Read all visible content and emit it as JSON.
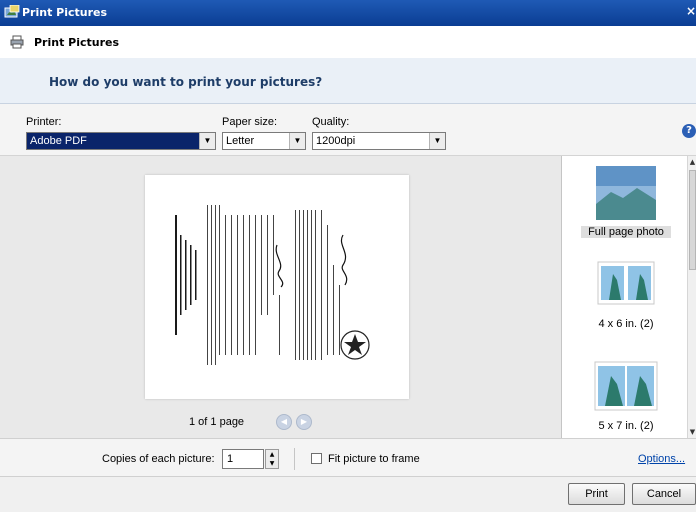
{
  "window": {
    "title": "Print Pictures"
  },
  "header": {
    "title": "Print Pictures",
    "question": "How do you want to print your pictures?"
  },
  "options": {
    "printer_label": "Printer:",
    "printer_value": "Adobe PDF",
    "paper_label": "Paper size:",
    "paper_value": "Letter",
    "quality_label": "Quality:",
    "quality_value": "1200dpi",
    "help_glyph": "?"
  },
  "preview": {
    "page_count": "1 of 1 page"
  },
  "layouts": [
    {
      "label": "Full page photo",
      "selected": true
    },
    {
      "label": "4 x 6 in. (2)",
      "selected": false
    },
    {
      "label": "5 x 7 in. (2)",
      "selected": false
    }
  ],
  "copies": {
    "label": "Copies of each picture:",
    "value": "1",
    "fit_label": "Fit picture to frame",
    "fit_checked": false,
    "options_link": "Options..."
  },
  "buttons": {
    "print": "Print",
    "cancel": "Cancel"
  },
  "colors": {
    "titlebar": "#0a3d93",
    "question": "#1e3d68",
    "selection": "#0a246a",
    "link": "#0044aa"
  }
}
